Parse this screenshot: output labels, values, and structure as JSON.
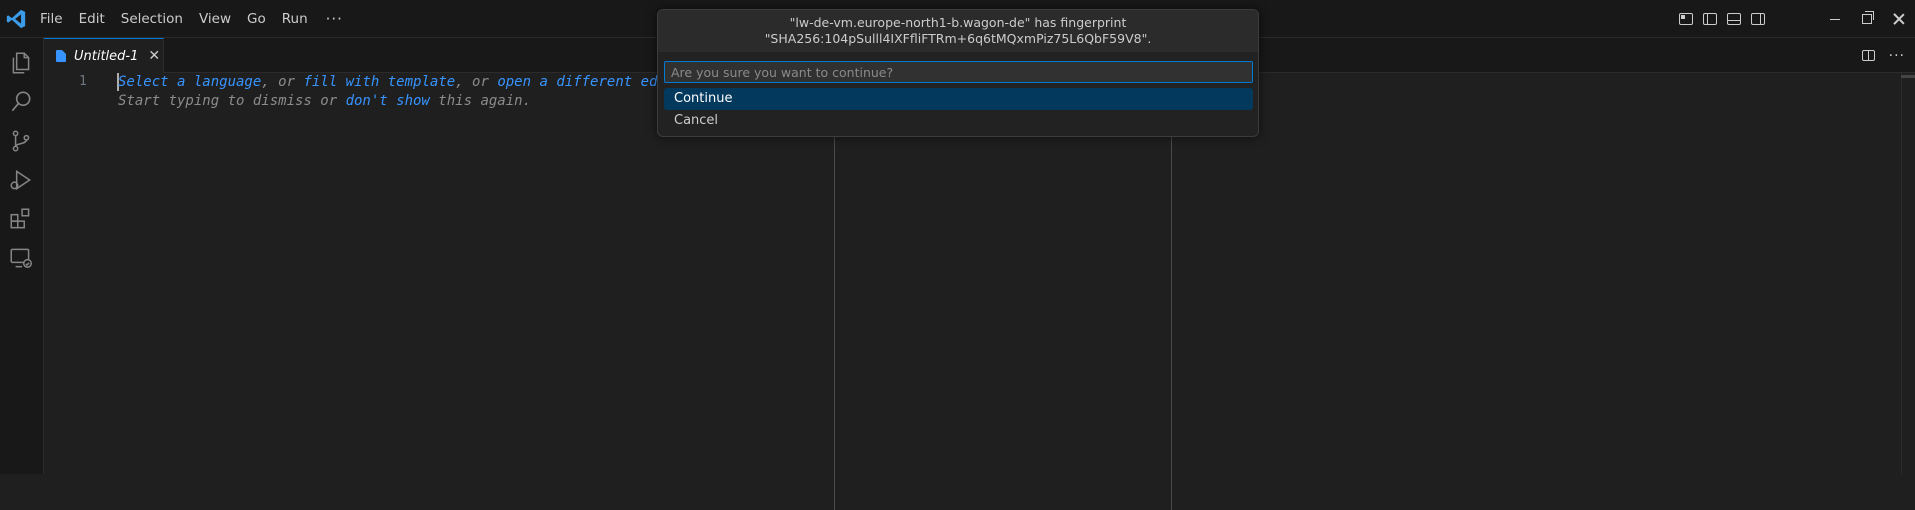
{
  "titlebar": {
    "menu": [
      "File",
      "Edit",
      "Selection",
      "View",
      "Go",
      "Run"
    ],
    "more": "···"
  },
  "activitybar": {
    "icons": [
      "explorer-icon",
      "search-icon",
      "source-control-icon",
      "run-debug-icon",
      "extensions-icon",
      "remote-explorer-icon"
    ]
  },
  "tabs": [
    {
      "label": "Untitled-1",
      "close": "✕"
    }
  ],
  "editor": {
    "line_number": "1",
    "hint1": {
      "part1": "Select a language",
      "part2": ", or ",
      "part3": "fill with template",
      "part4": ", or ",
      "part5": "open a different ed"
    },
    "hint2": {
      "part1": "Start typing to dismiss or ",
      "part2": "don't show",
      "part3": " this again."
    },
    "actions_more": "···"
  },
  "quick_pick": {
    "title_line1": "\"lw-de-vm.europe-north1-b.wagon-de\" has fingerprint",
    "title_line2": "\"SHA256:104pSulll4IXFfliFTRm+6q6tMQxmPiz75L6QbF59V8\".",
    "placeholder": "Are you sure you want to continue?",
    "options": [
      "Continue",
      "Cancel"
    ]
  },
  "colors": {
    "accent": "#0078d4",
    "selected_option_bg": "#04395e",
    "link": "#3794ff",
    "background": "#1f1f1f"
  }
}
